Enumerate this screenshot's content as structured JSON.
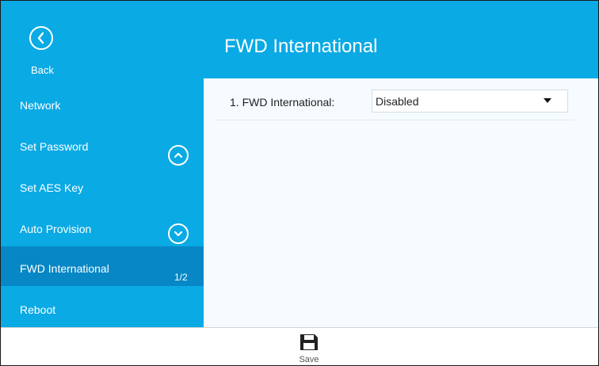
{
  "header": {
    "back_label": "Back",
    "title": "FWD International"
  },
  "sidebar": {
    "items": [
      {
        "label": "Network"
      },
      {
        "label": "Set Password"
      },
      {
        "label": "Set AES Key"
      },
      {
        "label": "Auto Provision"
      },
      {
        "label": "FWD International",
        "active": true
      },
      {
        "label": "Reboot"
      }
    ],
    "page_indicator": "1/2"
  },
  "content": {
    "rows": [
      {
        "label": "1. FWD International:",
        "value": "Disabled"
      }
    ]
  },
  "bottom": {
    "save_label": "Save"
  },
  "colors": {
    "accent": "#0aaae4",
    "active_item": "#0787c5",
    "content_bg": "#f5fbfe"
  },
  "icons": [
    "back-icon",
    "scroll-up-icon",
    "scroll-down-icon",
    "dropdown-arrow-icon",
    "save-icon"
  ]
}
